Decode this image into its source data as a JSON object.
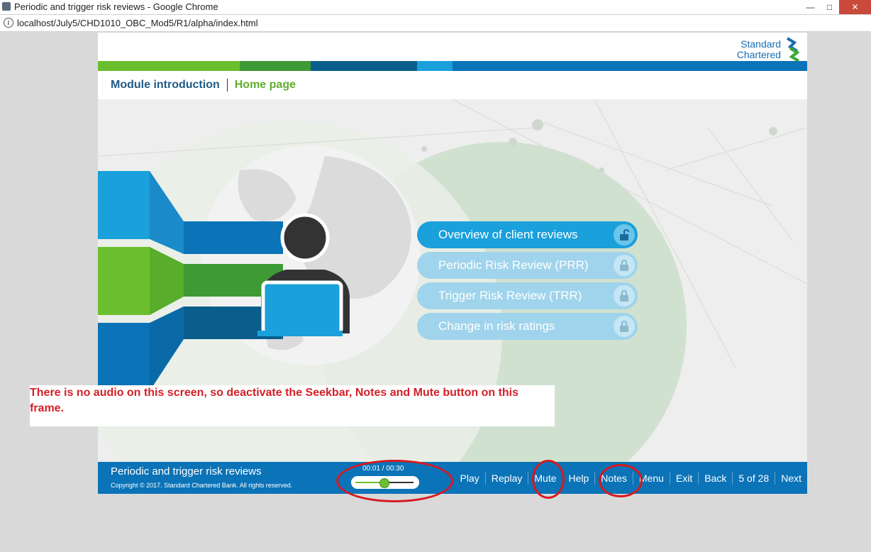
{
  "browser": {
    "tab_title": "Periodic and trigger risk reviews - Google Chrome",
    "url": "localhost/July5/CHD1010_OBC_Mod5/R1/alpha/index.html",
    "window_buttons": {
      "minimize": "—",
      "maximize": "□",
      "close": "✕"
    }
  },
  "logo": {
    "line1": "Standard",
    "line2": "Chartered"
  },
  "colors": {
    "colorbar": [
      "#6bbf2f",
      "#3e9a35",
      "#0a5e8c",
      "#1aa0db",
      "#0b73b7"
    ],
    "footer": "#0b73b7",
    "annotation_text": "#d42027",
    "markup": "#d7191f",
    "home_green": "#5fae2e",
    "module_blue": "#1f5b86"
  },
  "breadcrumb": {
    "module": "Module introduction",
    "page": "Home page"
  },
  "menu": [
    {
      "label": "Overview of client reviews",
      "locked": false,
      "icon": "unlock-icon"
    },
    {
      "label": "Periodic Risk Review (PRR)",
      "locked": true,
      "icon": "lock-icon"
    },
    {
      "label": "Trigger Risk Review (TRR)",
      "locked": true,
      "icon": "lock-icon"
    },
    {
      "label": "Change in risk ratings",
      "locked": true,
      "icon": "lock-icon"
    }
  ],
  "annotation": "There is no audio on this screen, so deactivate the Seekbar, Notes and Mute button on this frame.",
  "footer": {
    "title": "Periodic and trigger risk reviews",
    "copyright": "Copyright © 2017. Standard Chartered Bank. All rights reserved.",
    "seek_time": "00:01 / 00:30",
    "seek_progress": 0.5,
    "nav": {
      "play": "Play",
      "replay": "Replay",
      "mute": "Mute",
      "help": "Help",
      "notes": "Notes",
      "menu": "Menu",
      "exit": "Exit",
      "back": "Back",
      "page": "5 of 28",
      "next": "Next"
    }
  }
}
